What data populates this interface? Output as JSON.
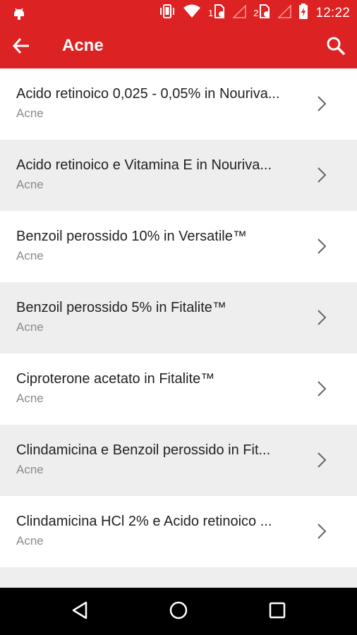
{
  "status_bar": {
    "time": "12:22",
    "sim1_label": "1",
    "sim2_label": "2",
    "icons": [
      "android-icon",
      "vibrate-icon",
      "wifi-icon",
      "sim1-icon",
      "signal1-icon",
      "sim2-icon",
      "signal2-icon",
      "battery-charging-icon"
    ]
  },
  "app_bar": {
    "title": "Acne",
    "back_icon": "arrow-back-icon",
    "search_icon": "search-icon"
  },
  "list": {
    "items": [
      {
        "name": "Acido retinoico 0,025 - 0,05% in Nouriva...",
        "category": "Acne"
      },
      {
        "name": "Acido retinoico e Vitamina E in Nouriva...",
        "category": "Acne"
      },
      {
        "name": "Benzoil perossido 10% in Versatile™",
        "category": "Acne"
      },
      {
        "name": "Benzoil perossido 5% in Fitalite™",
        "category": "Acne"
      },
      {
        "name": "Ciproterone acetato in Fitalite™",
        "category": "Acne"
      },
      {
        "name": "Clindamicina e Benzoil perossido in Fit...",
        "category": "Acne"
      },
      {
        "name": "Clindamicina HCl 2% e Acido retinoico ...",
        "category": "Acne"
      },
      {
        "name": "",
        "category": ""
      }
    ]
  },
  "nav_bar": {
    "icons": [
      "back-triangle-icon",
      "home-circle-icon",
      "recents-square-icon"
    ]
  },
  "colors": {
    "primary": "#dc2222",
    "alt_row": "#eeeeee",
    "nav": "#000000"
  }
}
